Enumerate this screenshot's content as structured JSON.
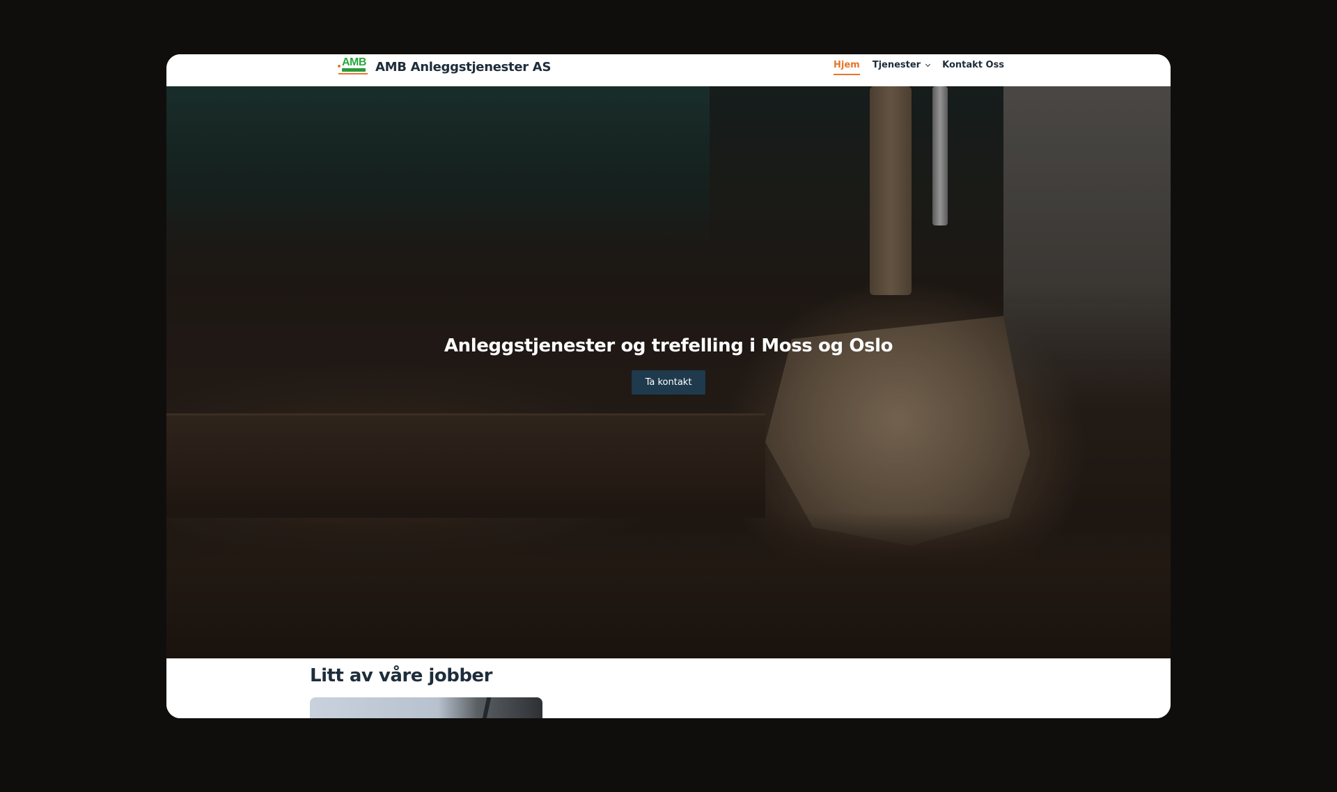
{
  "header": {
    "logo_text": "AMB",
    "brand_name": "AMB Anleggstjenester AS",
    "nav": {
      "home": "Hjem",
      "services": "Tjenester",
      "contact": "Kontakt Oss"
    }
  },
  "hero": {
    "title": "Anleggstjenester og trefelling i Moss og Oslo",
    "cta_label": "Ta kontakt"
  },
  "jobs": {
    "title": "Litt av våre jobber"
  },
  "colors": {
    "accent": "#e8742a",
    "brand_dark": "#1e2d3b",
    "cta_bg": "#1e3a4c",
    "logo_green": "#26a83c"
  }
}
